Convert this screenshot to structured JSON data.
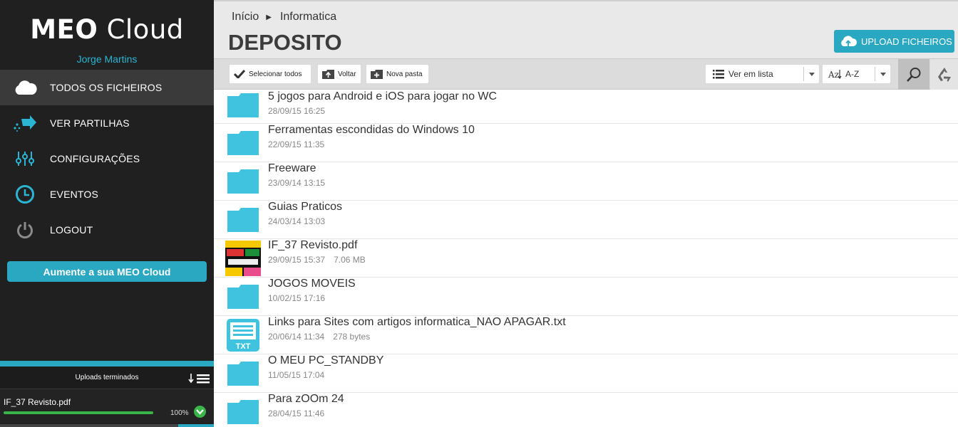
{
  "app": {
    "logo_bold": "MEO",
    "logo_light": "Cloud",
    "user_name": "Jorge Martins"
  },
  "sidebar": {
    "items": [
      {
        "label": "TODOS OS FICHEIROS",
        "icon": "cloud-icon",
        "active": true
      },
      {
        "label": "VER PARTILHAS",
        "icon": "share-icon"
      },
      {
        "label": "CONFIGURAÇÕES",
        "icon": "sliders-icon"
      },
      {
        "label": "EVENTOS",
        "icon": "clock-icon"
      },
      {
        "label": "LOGOUT",
        "icon": "power-icon"
      }
    ],
    "upgrade_label": "Aumente a sua MEO Cloud"
  },
  "uploads": {
    "title": "Uploads terminados",
    "item": {
      "name": "IF_37 Revisto.pdf",
      "progress": 100,
      "percent_label": "100%"
    }
  },
  "header": {
    "breadcrumb": [
      "Início",
      "Informatica"
    ],
    "title": "DEPOSITO",
    "upload_label": "UPLOAD FICHEIROS"
  },
  "toolbar": {
    "select_all": "Selecionar todos",
    "back": "Voltar",
    "new_folder": "Nova pasta",
    "view_mode": "Ver em lista",
    "sort": "A-Z"
  },
  "files": [
    {
      "name": "5 jogos para Android e iOS para jogar no WC",
      "date": "28/09/15 16:25",
      "type": "folder"
    },
    {
      "name": "Ferramentas escondidas do Windows 10",
      "date": "22/09/15 11:35",
      "type": "folder"
    },
    {
      "name": "Freeware",
      "date": "23/09/14 13:15",
      "type": "folder"
    },
    {
      "name": "Guias Praticos",
      "date": "24/03/14 13:03",
      "type": "folder"
    },
    {
      "name": "IF_37 Revisto.pdf",
      "date": "29/09/15 15:37",
      "size": "7.06 MB",
      "type": "pdf"
    },
    {
      "name": "JOGOS MOVEIS",
      "date": "10/02/15 17:16",
      "type": "folder"
    },
    {
      "name": "Links para Sites com artigos informatica_NAO APAGAR.txt",
      "date": "20/06/14 11:34",
      "size": "278 bytes",
      "type": "txt",
      "badge": "TXT"
    },
    {
      "name": "O MEU PC_STANDBY",
      "date": "11/05/15 17:04",
      "type": "folder"
    },
    {
      "name": "Para zOOm 24",
      "date": "28/04/15 11:46",
      "type": "folder"
    }
  ],
  "colors": {
    "accent": "#2aa7c1",
    "folder": "#3fc3de",
    "sidebar_bg": "#202020",
    "success": "#39b54a"
  }
}
